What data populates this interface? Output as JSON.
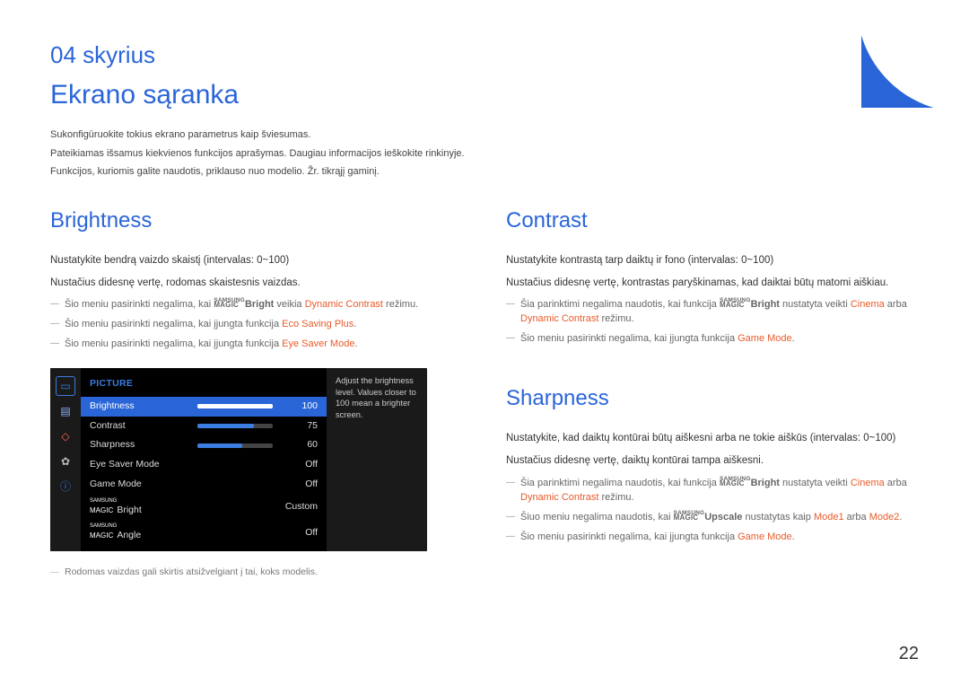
{
  "chapter": "04 skyrius",
  "title": "Ekrano sąranka",
  "intro": [
    "Sukonfigūruokite tokius ekrano parametrus kaip šviesumas.",
    "Pateikiamas išsamus kiekvienos funkcijos aprašymas. Daugiau informacijos ieškokite rinkinyje.",
    "Funkcijos, kuriomis galite naudotis, priklauso nuo modelio. Žr. tikrąjį gaminį."
  ],
  "left": {
    "heading": "Brightness",
    "p1": "Nustatykite bendrą vaizdo skaistį (intervalas: 0~100)",
    "p2": "Nustačius didesnę vertę, rodomas skaistesnis vaizdas.",
    "notes": {
      "n1a": "Šio meniu pasirinkti negalima, kai ",
      "n1b": "Bright",
      "n1c": " veikia ",
      "n1d": "Dynamic Contrast",
      "n1e": " režimu.",
      "n2a": "Šio meniu pasirinkti negalima, kai įjungta funkcija ",
      "n2b": "Eco Saving Plus",
      "n2c": ".",
      "n3a": "Šio meniu pasirinkti negalima, kai įjungta funkcija ",
      "n3b": "Eye Saver Mode",
      "n3c": "."
    },
    "footnote": "Rodomas vaizdas gali skirtis atsižvelgiant į tai, koks modelis."
  },
  "osd": {
    "header": "PICTURE",
    "rows": [
      {
        "label": "Brightness",
        "value": "100",
        "pct": 100,
        "type": "slider",
        "selected": true
      },
      {
        "label": "Contrast",
        "value": "75",
        "pct": 75,
        "type": "slider"
      },
      {
        "label": "Sharpness",
        "value": "60",
        "pct": 60,
        "type": "slider"
      },
      {
        "label": "Eye Saver Mode",
        "value": "Off",
        "type": "opt"
      },
      {
        "label": "Game Mode",
        "value": "Off",
        "type": "opt"
      },
      {
        "label": "MAGICBright",
        "value": "Custom",
        "type": "opt",
        "magic": true,
        "suffix": "Bright"
      },
      {
        "label": "MAGICAngle",
        "value": "Off",
        "type": "opt",
        "magic": true,
        "suffix": "Angle"
      }
    ],
    "desc": "Adjust the brightness level. Values closer to 100 mean a brighter screen.",
    "magic_top": "SAMSUNG",
    "magic_bot": "MAGIC"
  },
  "right": {
    "contrast": {
      "heading": "Contrast",
      "p1": "Nustatykite kontrastą tarp daiktų ir fono (intervalas: 0~100)",
      "p2": "Nustačius didesnę vertę, kontrastas paryškinamas, kad daiktai būtų matomi aiškiau.",
      "n1a": "Šia parinktimi negalima naudotis, kai funkcija ",
      "n1b": "Bright",
      "n1c": " nustatyta veikti ",
      "n1d": "Cinema",
      "n1e": " arba ",
      "n1f": "Dynamic Contrast",
      "n1g": " režimu.",
      "n2a": "Šio meniu pasirinkti negalima, kai įjungta funkcija ",
      "n2b": "Game Mode",
      "n2c": "."
    },
    "sharpness": {
      "heading": "Sharpness",
      "p1": "Nustatykite, kad daiktų kontūrai būtų aiškesni arba ne tokie aiškūs (intervalas: 0~100)",
      "p2": "Nustačius didesnę vertę, daiktų kontūrai tampa aiškesni.",
      "n1a": "Šia parinktimi negalima naudotis, kai funkcija ",
      "n1b": "Bright",
      "n1c": " nustatyta veikti ",
      "n1d": "Cinema",
      "n1e": " arba ",
      "n1f": "Dynamic Contrast",
      "n1g": " režimu.",
      "n2a": "Šiuo meniu negalima naudotis, kai ",
      "n2b": "Upscale",
      "n2c": " nustatytas kaip ",
      "n2d": "Mode1",
      "n2e": " arba ",
      "n2f": "Mode2",
      "n2g": ".",
      "n3a": "Šio meniu pasirinkti negalima, kai įjungta funkcija ",
      "n3b": "Game Mode",
      "n3c": "."
    }
  },
  "pagenum": "22"
}
